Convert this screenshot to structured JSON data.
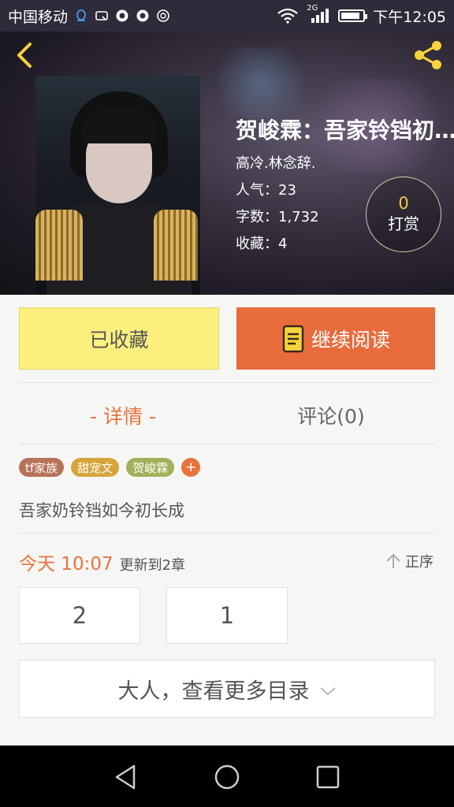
{
  "status_bar": {
    "carrier": "中国移动",
    "network": "2G",
    "time": "下午12:05",
    "battery_level": 0.75
  },
  "header": {
    "back_icon": "back-arrow-icon",
    "share_icon": "share-icon"
  },
  "book": {
    "title": "贺峻霖：吾家铃铛初…",
    "author": "高冷.林念辞.",
    "popularity": "人气：23",
    "word_count": "字数：1,732",
    "favorites": "收藏：4",
    "reward_count": "0",
    "reward_label": "打赏"
  },
  "actions": {
    "collected_label": "已收藏",
    "read_label": "继续阅读",
    "collected_color": "#fbf07e",
    "read_color": "#e86b3b"
  },
  "tabs": {
    "detail": "- 详情 -",
    "comments": "评论(0)"
  },
  "tags": [
    {
      "label": "tf家族",
      "color": "#b7735a"
    },
    {
      "label": "甜宠文",
      "color": "#d7a43b"
    },
    {
      "label": "贺峻霖",
      "color": "#9fb15a"
    }
  ],
  "tag_add": "+",
  "summary": "吾家奶铃铛如今初长成",
  "update": {
    "time": "今天 10:07",
    "text": "更新到2章",
    "sort_label": "正序"
  },
  "chapters": [
    "2",
    "1"
  ],
  "more_label": "大人，查看更多目录",
  "accent_color": "#e8733d"
}
